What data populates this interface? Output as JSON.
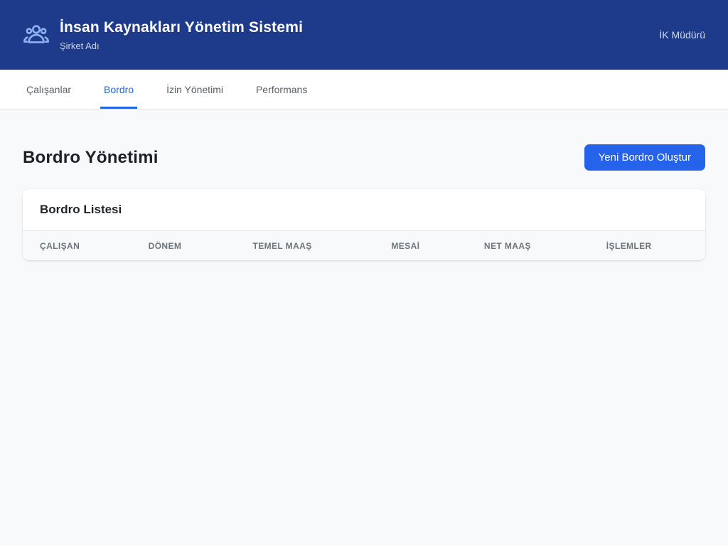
{
  "header": {
    "title": "İnsan Kaynakları Yönetim Sistemi",
    "subtitle": "Şirket Adı",
    "user_role": "İK Müdürü",
    "logo_icon": "people-group-icon"
  },
  "nav": {
    "tabs": [
      {
        "label": "Çalışanlar",
        "active": false
      },
      {
        "label": "Bordro",
        "active": true
      },
      {
        "label": "İzin Yönetimi",
        "active": false
      },
      {
        "label": "Performans",
        "active": false
      }
    ]
  },
  "main": {
    "page_title": "Bordro Yönetimi",
    "new_payroll_button": "Yeni Bordro Oluştur",
    "card": {
      "title": "Bordro Listesi",
      "table": {
        "columns": [
          "ÇALIŞAN",
          "DÖNEM",
          "TEMEL MAAŞ",
          "MESAİ",
          "NET MAAŞ",
          "İŞLEMLER"
        ],
        "rows": []
      }
    }
  },
  "colors": {
    "header_bg": "#1e3a8a",
    "accent": "#2563eb",
    "icon_blue": "#8bb1f0",
    "page_bg": "#f8f9fa",
    "muted_text": "#6c757d"
  }
}
